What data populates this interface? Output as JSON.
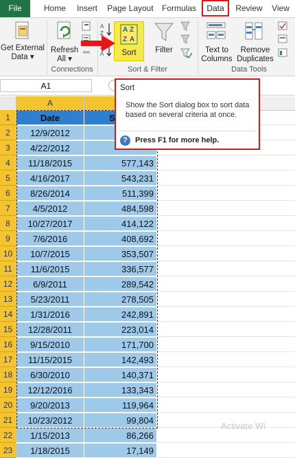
{
  "tabs": [
    "File",
    "Home",
    "Insert",
    "Page Layout",
    "Formulas",
    "Data",
    "Review",
    "View"
  ],
  "ribbon": {
    "get_external_data": "Get External Data ▾",
    "refresh_all": "Refresh All ▾",
    "sort": "Sort",
    "filter": "Filter",
    "text_to_columns": "Text to Columns",
    "remove_duplicates": "Remove Duplicates",
    "group_connections": "Connections",
    "group_sort_filter": "Sort & Filter",
    "group_data_tools": "Data Tools"
  },
  "name_box": "A1",
  "columns": {
    "a": "A"
  },
  "header_row": {
    "date": "Date",
    "sales": "Sa"
  },
  "rows": [
    {
      "num": "1"
    },
    {
      "num": "2",
      "date": "12/9/2012",
      "value": ""
    },
    {
      "num": "3",
      "date": "4/22/2012",
      "value": ""
    },
    {
      "num": "4",
      "date": "11/18/2015",
      "value": "577,143"
    },
    {
      "num": "5",
      "date": "4/16/2017",
      "value": "543,231"
    },
    {
      "num": "6",
      "date": "8/26/2014",
      "value": "511,399"
    },
    {
      "num": "7",
      "date": "4/5/2012",
      "value": "484,598"
    },
    {
      "num": "8",
      "date": "10/27/2017",
      "value": "414,122"
    },
    {
      "num": "9",
      "date": "7/6/2016",
      "value": "408,692"
    },
    {
      "num": "10",
      "date": "10/7/2015",
      "value": "353,507"
    },
    {
      "num": "11",
      "date": "11/6/2015",
      "value": "336,577"
    },
    {
      "num": "12",
      "date": "6/9/2011",
      "value": "289,542"
    },
    {
      "num": "13",
      "date": "5/23/2011",
      "value": "278,505"
    },
    {
      "num": "14",
      "date": "1/31/2016",
      "value": "242,891"
    },
    {
      "num": "15",
      "date": "12/28/2011",
      "value": "223,014"
    },
    {
      "num": "16",
      "date": "9/15/2010",
      "value": "171,700"
    },
    {
      "num": "17",
      "date": "11/15/2015",
      "value": "142,493"
    },
    {
      "num": "18",
      "date": "6/30/2010",
      "value": "140,371"
    },
    {
      "num": "19",
      "date": "12/12/2016",
      "value": "133,343"
    },
    {
      "num": "20",
      "date": "9/20/2013",
      "value": "119,964"
    },
    {
      "num": "21",
      "date": "10/23/2012",
      "value": "99,804"
    },
    {
      "num": "22",
      "date": "1/15/2013",
      "value": "86,266"
    },
    {
      "num": "23",
      "date": "1/18/2015",
      "value": "17,149"
    }
  ],
  "tooltip": {
    "title": "Sort",
    "body": "Show the Sort dialog box to sort data based on several criteria at once.",
    "help": "Press F1 for more help.",
    "help_icon": "?"
  },
  "watermark": "Activate Wi",
  "colors": {
    "highlight_red": "#e0141a",
    "excel_green": "#217346",
    "cell_blue": "#9fc9e9",
    "header_yellow": "#f4c430"
  }
}
